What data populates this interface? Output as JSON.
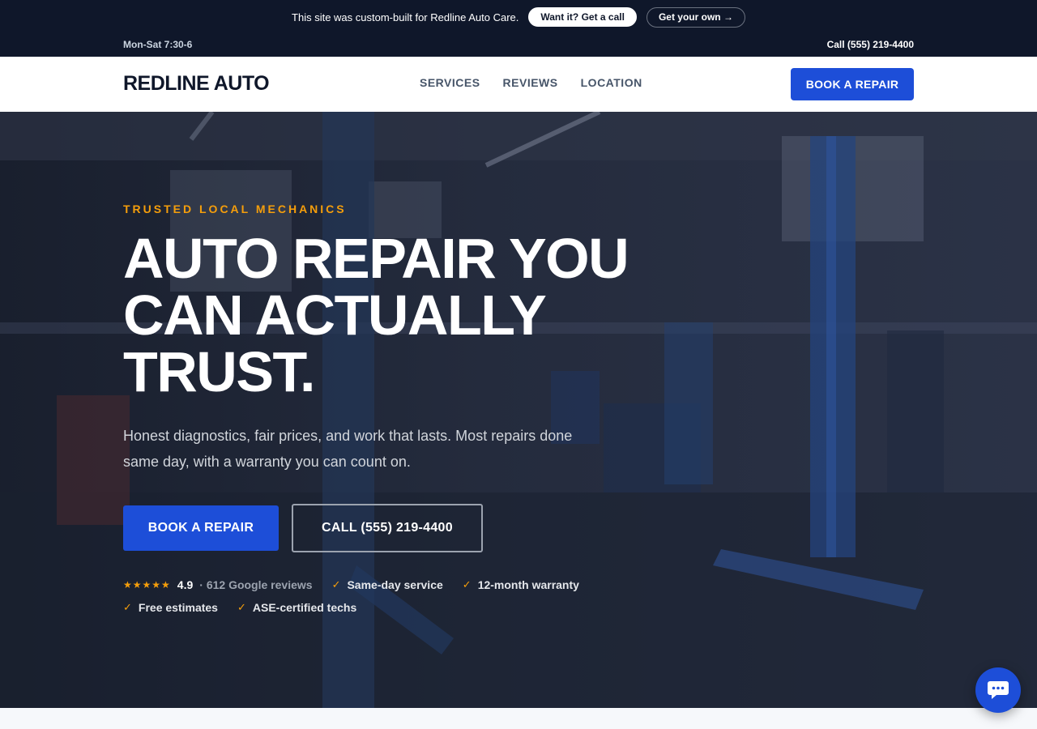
{
  "promo": {
    "text": "This site was custom-built for Redline Auto Care.",
    "primary_label": "Want it? Get a call",
    "secondary_label": "Get your own →"
  },
  "utility": {
    "hours": "Mon-Sat 7:30-6",
    "call": "Call (555) 219-4400"
  },
  "header": {
    "logo": "REDLINE AUTO",
    "nav": [
      {
        "label": "SERVICES"
      },
      {
        "label": "REVIEWS"
      },
      {
        "label": "LOCATION"
      }
    ],
    "cta_label": "BOOK A REPAIR"
  },
  "hero": {
    "eyebrow": "TRUSTED LOCAL MECHANICS",
    "headline_lines": [
      "AUTO REPAIR YOU",
      "CAN ACTUALLY",
      "TRUST."
    ],
    "subhead": "Honest diagnostics, fair prices, and work that lasts. Most repairs done same day, with a warranty you can count on.",
    "cta_primary": "BOOK A REPAIR",
    "cta_secondary": "CALL (555) 219-4400",
    "rating": {
      "stars": "★★★★★",
      "score": "4.9",
      "count": "· 612 Google reviews"
    },
    "badges": [
      {
        "label": "Same-day service"
      },
      {
        "label": "12-month warranty"
      },
      {
        "label": "Free estimates"
      },
      {
        "label": "ASE-certified techs"
      }
    ],
    "check_glyph": "✓"
  },
  "colors": {
    "dark": "#0f172a",
    "accent_blue": "#1d4ed8",
    "accent_orange": "#f59e0b"
  },
  "icons": {
    "chat": "chat-bubble-icon"
  }
}
